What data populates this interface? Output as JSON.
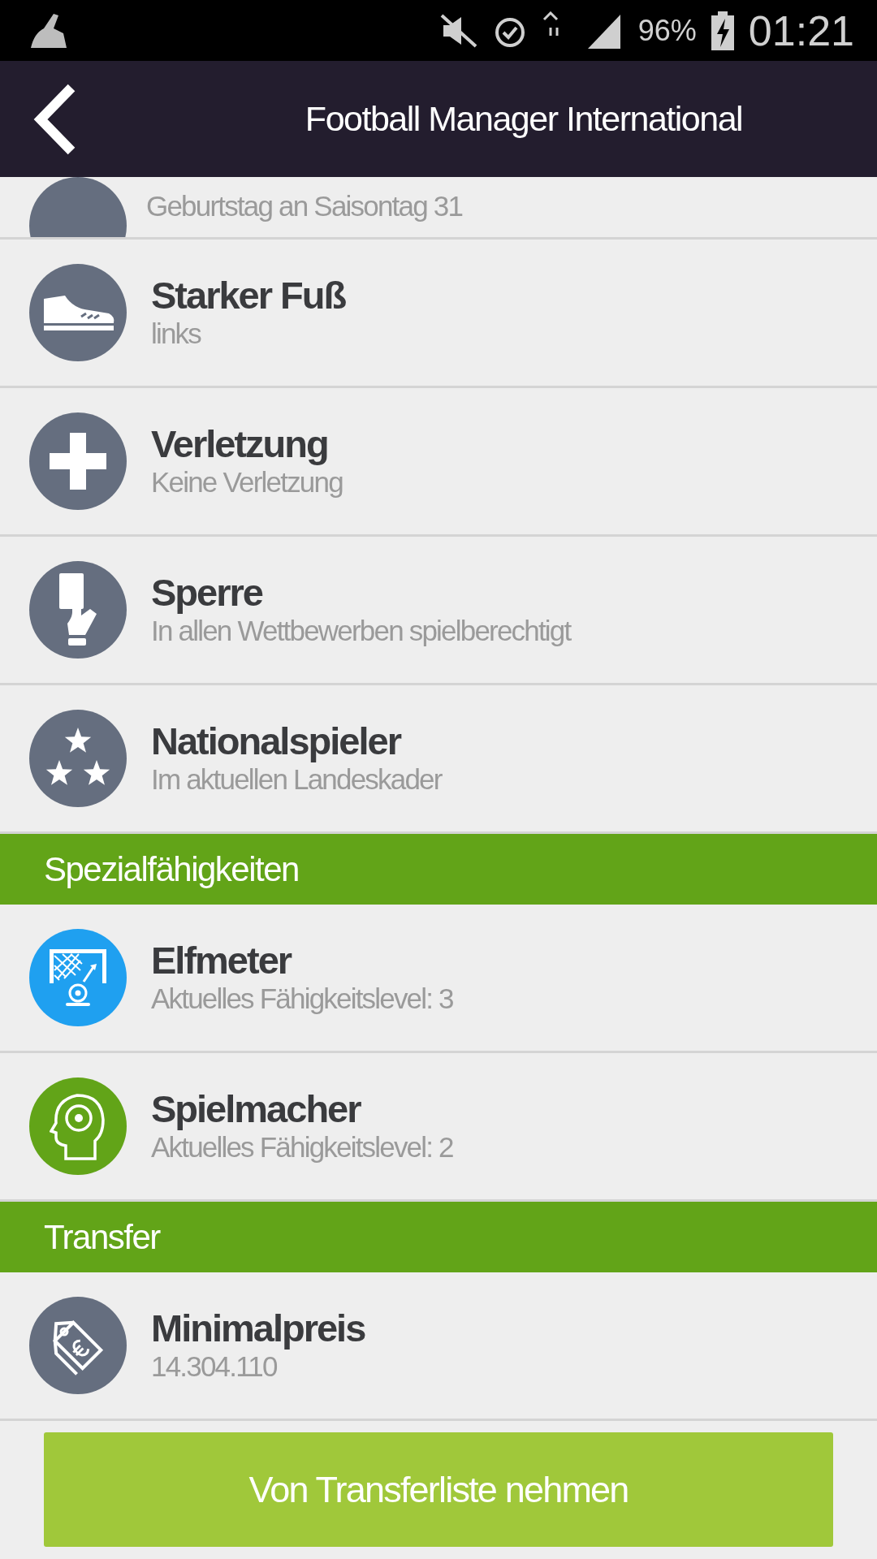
{
  "status_bar": {
    "battery": "96%",
    "time": "01:21"
  },
  "header": {
    "title": "Football Manager International"
  },
  "partial_row": {
    "subtitle": "Geburtstag an Saisontag 31"
  },
  "sections": [
    {
      "items": [
        {
          "kind": "shoe",
          "color": "#656e7f",
          "title": "Starker Fuß",
          "subtitle": "links"
        },
        {
          "kind": "cross",
          "color": "#656e7f",
          "title": "Verletzung",
          "subtitle": "Keine Verletzung"
        },
        {
          "kind": "card",
          "color": "#656e7f",
          "title": "Sperre",
          "subtitle": "In allen Wettbewerben spielberechtigt"
        },
        {
          "kind": "stars",
          "color": "#656e7f",
          "title": "Nationalspieler",
          "subtitle": "Im aktuellen Landeskader"
        }
      ]
    },
    {
      "title": "Spezialfähigkeiten",
      "items": [
        {
          "kind": "goal",
          "color": "#1fa0f0",
          "title": "Elfmeter",
          "subtitle": "Aktuelles Fähigkeitslevel: 3"
        },
        {
          "kind": "head",
          "color": "#62a418",
          "title": "Spielmacher",
          "subtitle": "Aktuelles Fähigkeitslevel: 2"
        }
      ]
    },
    {
      "title": "Transfer",
      "items": [
        {
          "kind": "tag",
          "color": "#656e7f",
          "title": "Minimalpreis",
          "subtitle": "14.304.110"
        }
      ]
    }
  ],
  "button": "Von Transferliste nehmen"
}
